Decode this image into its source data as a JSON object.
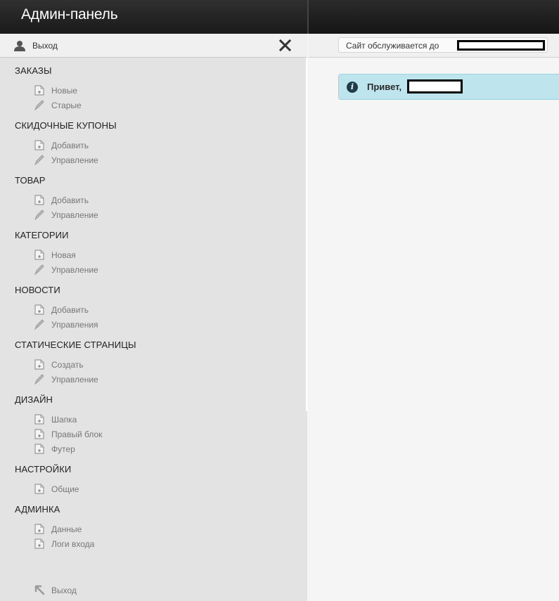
{
  "header": {
    "title": "Админ-панель"
  },
  "sidebar": {
    "logout_top": "Выход",
    "sections": [
      {
        "title": "ЗАКАЗЫ",
        "items": [
          {
            "label": "Новые",
            "icon": "page-add-icon"
          },
          {
            "label": "Старые",
            "icon": "pencil-icon"
          }
        ]
      },
      {
        "title": "СКИДОЧНЫЕ КУПОНЫ",
        "items": [
          {
            "label": "Добавить",
            "icon": "page-add-icon"
          },
          {
            "label": "Управление",
            "icon": "pencil-icon"
          }
        ]
      },
      {
        "title": "ТОВАР",
        "items": [
          {
            "label": "Добавить",
            "icon": "page-add-icon"
          },
          {
            "label": "Управление",
            "icon": "pencil-icon"
          }
        ]
      },
      {
        "title": "КАТЕГОРИИ",
        "items": [
          {
            "label": "Новая",
            "icon": "page-add-icon"
          },
          {
            "label": "Управление",
            "icon": "pencil-icon"
          }
        ]
      },
      {
        "title": "НОВОСТИ",
        "items": [
          {
            "label": "Добавить",
            "icon": "page-add-icon"
          },
          {
            "label": "Управления",
            "icon": "pencil-icon"
          }
        ]
      },
      {
        "title": "СТАТИЧЕСКИЕ СТРАНИЦЫ",
        "items": [
          {
            "label": "Создать",
            "icon": "page-add-icon"
          },
          {
            "label": "Управление",
            "icon": "pencil-icon"
          }
        ]
      },
      {
        "title": "ДИЗАЙН",
        "items": [
          {
            "label": "Шапка",
            "icon": "page-add-icon"
          },
          {
            "label": "Правый блок",
            "icon": "page-add-icon"
          },
          {
            "label": "Футер",
            "icon": "page-add-icon"
          }
        ]
      },
      {
        "title": "НАСТРОЙКИ",
        "items": [
          {
            "label": "Общие",
            "icon": "page-add-icon"
          }
        ]
      },
      {
        "title": "АДМИНКА",
        "items": [
          {
            "label": "Данные",
            "icon": "page-add-icon"
          },
          {
            "label": "Логи входа",
            "icon": "page-add-icon"
          }
        ]
      }
    ],
    "logout_bottom": "Выход"
  },
  "main": {
    "service_label": "Сайт обслуживается до",
    "greeting": "Привет,"
  }
}
